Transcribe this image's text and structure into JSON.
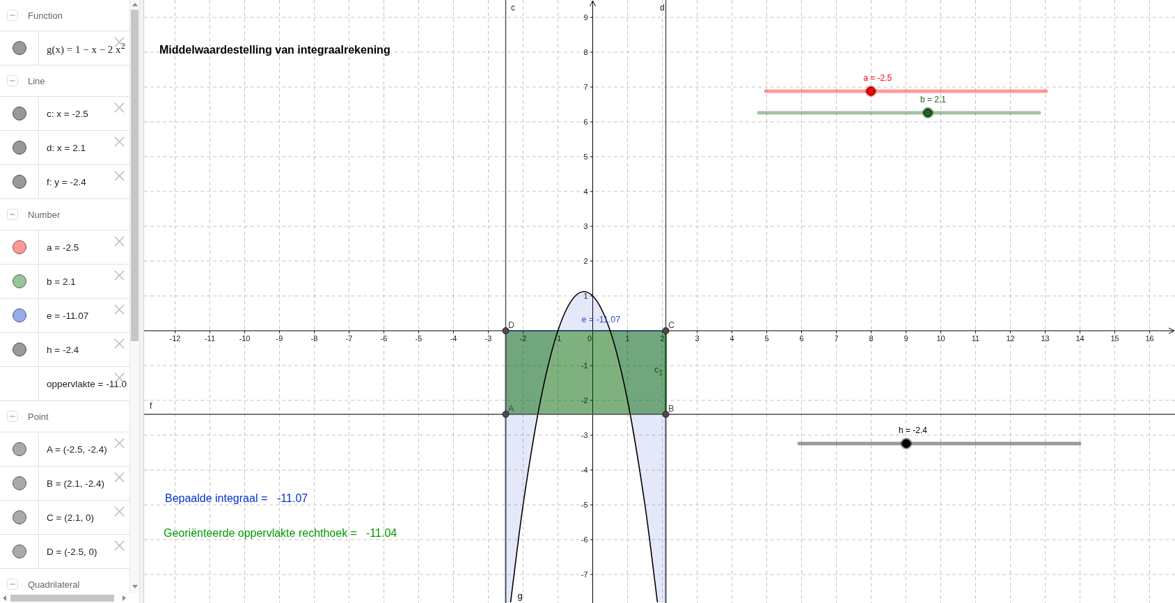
{
  "algebra_view": {
    "groups": [
      {
        "title": "Function",
        "expanded": true,
        "items": [
          {
            "kind": "formula",
            "text": "g(x) = 1 − x − 2 x$^{2}$",
            "color": "#999999"
          }
        ]
      },
      {
        "title": "Line",
        "expanded": true,
        "items": [
          {
            "kind": "value",
            "text": "c: x = -2.5",
            "color": "#999999"
          },
          {
            "kind": "value",
            "text": "d: x = 2.1",
            "color": "#999999"
          },
          {
            "kind": "value",
            "text": "f: y = -2.4",
            "color": "#999999"
          }
        ]
      },
      {
        "title": "Number",
        "expanded": true,
        "items": [
          {
            "kind": "value",
            "text": "a = -2.5",
            "color": "#ff9999"
          },
          {
            "kind": "value",
            "text": "b = 2.1",
            "color": "#99c499"
          },
          {
            "kind": "value",
            "text": "e = -11.07",
            "color": "#99aaee"
          },
          {
            "kind": "value",
            "text": "h = -2.4",
            "color": "#999999"
          },
          {
            "kind": "value",
            "text": "oppervlakte = -11.0"
          }
        ]
      },
      {
        "title": "Point",
        "expanded": true,
        "items": [
          {
            "kind": "value",
            "text": "A = (-2.5, -2.4)",
            "color": "#aaaaaa"
          },
          {
            "kind": "value",
            "text": "B = (2.1, -2.4)",
            "color": "#aaaaaa"
          },
          {
            "kind": "value",
            "text": "C = (2.1, 0)",
            "color": "#aaaaaa"
          },
          {
            "kind": "value",
            "text": "D = (-2.5, 0)",
            "color": "#aaaaaa"
          }
        ]
      },
      {
        "title": "Quadrilateral",
        "expanded": true
      }
    ]
  },
  "graphics_view": {
    "title": "Middelwaardestelling van integraalrekening",
    "sliders": [
      {
        "label": "a = -2.5",
        "level": 0.375,
        "color": "#ff0000"
      },
      {
        "label": "b = 2.1",
        "level": 0.603,
        "color": "#1e631e"
      },
      {
        "label": "h = -2.4",
        "level": 0.382,
        "color": "#000000"
      }
    ],
    "texts": [
      {
        "caption": "Bepaalde integraal =",
        "value": "-11.07",
        "color": "#0033cc"
      },
      {
        "caption": "Georiënteerde oppervlakte rechthoek =",
        "value": "-11.04",
        "color": "#009900"
      }
    ],
    "chart_data": {
      "type": "line",
      "grid": true,
      "x": [
        -2.36,
        -2,
        -1.5,
        -1,
        -0.5,
        0,
        0.5,
        1,
        1.5,
        1.86
      ],
      "series": [
        {
          "name": "g",
          "color": "#000000",
          "values": [
            -7.8,
            -5,
            -2,
            0,
            1,
            1,
            0,
            -2,
            -5,
            -7.8
          ]
        }
      ],
      "xticks": [
        -12,
        -11,
        -10,
        -9,
        -8,
        -7,
        -6,
        -5,
        -4,
        -3,
        -2,
        -1,
        0,
        1,
        2,
        3,
        4,
        5,
        6,
        7,
        8,
        9,
        10,
        11,
        12,
        13,
        14,
        15,
        16
      ],
      "yticks": [
        -7,
        -6,
        -5,
        -4,
        -3,
        -2,
        -1,
        1,
        2,
        3,
        4,
        5,
        6,
        7,
        8,
        9
      ],
      "xlim": [
        -12.89,
        16.73
      ],
      "ylim": [
        -7.82,
        9.5
      ],
      "ref_lines": [
        {
          "axis": "x",
          "value": -2.5,
          "label": "c",
          "color": "#4a4a4a"
        },
        {
          "axis": "x",
          "value": 2.1,
          "label": "d",
          "color": "#4a4a4a"
        },
        {
          "axis": "y",
          "value": -2.4,
          "label": "f",
          "color": "#4a4a4a"
        }
      ],
      "annotations": [
        "e = -11.07",
        "c$_{1}$",
        "A",
        "B",
        "C",
        "D"
      ]
    }
  }
}
